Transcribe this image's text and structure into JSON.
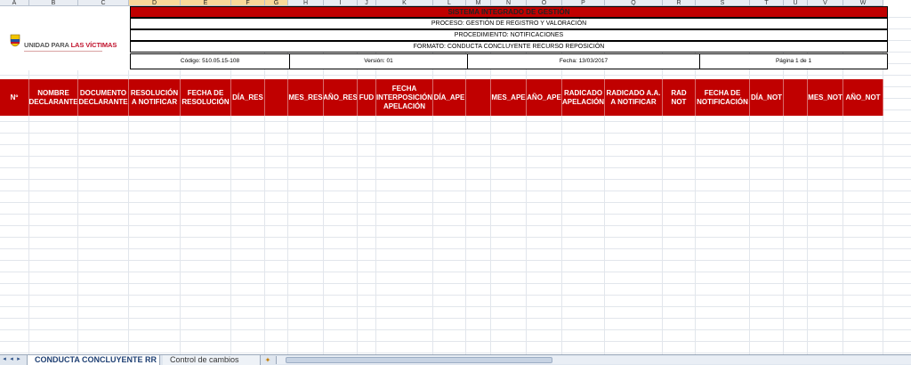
{
  "column_letters": [
    "A",
    "B",
    "C",
    "D",
    "E",
    "F",
    "G",
    "H",
    "I",
    "J",
    "K",
    "L",
    "M",
    "N",
    "O",
    "P",
    "Q",
    "R",
    "S",
    "T",
    "U",
    "V",
    "W"
  ],
  "logo": {
    "brand_prefix": "UNIDAD PARA ",
    "brand_bold": "LAS VÍCTIMAS"
  },
  "header": {
    "title": "SISTEMA INTEGRADO DE GESTIÓN",
    "proceso": "PROCESO: GESTIÓN DE REGISTRO Y VALORACIÓN",
    "procedimiento": "PROCEDIMIENTO: NOTIFICACIONES",
    "formato": "FORMATO: CONDUCTA CONCLUYENTE RECURSO REPOSICIÓN",
    "codigo": "Código: 510.05.15-108",
    "version": "Versión: 01",
    "fecha": "Fecha: 13/03/2017",
    "pagina": "Página 1 de 1"
  },
  "columns": [
    "Nº",
    "NOMBRE DECLARANTE",
    "DOCUMENTO DECLARANTE",
    "RESOLUCIÓN A NOTIFICAR",
    "FECHA DE RESOLUCIÓN",
    "DÍA_RES",
    "",
    "MES_RES",
    "AÑO_RES",
    "FUD",
    "FECHA INTERPOSICIÓN APELACIÓN",
    "DÍA_APE",
    "",
    "MES_APE",
    "AÑO_APE",
    "RADICADO APELACIÓN",
    "RADICADO A.A. A NOTIFICAR",
    "RAD NOT",
    "FECHA DE NOTIFICACIÓN",
    "DÍA_NOT",
    "",
    "MES_NOT",
    "AÑO_NOT"
  ],
  "tabs": {
    "active": "CONDUCTA CONCLUYENTE RR",
    "second": "Control de cambios"
  },
  "colors": {
    "header_red": "#c00000",
    "tab_text": "#1e3f73"
  }
}
